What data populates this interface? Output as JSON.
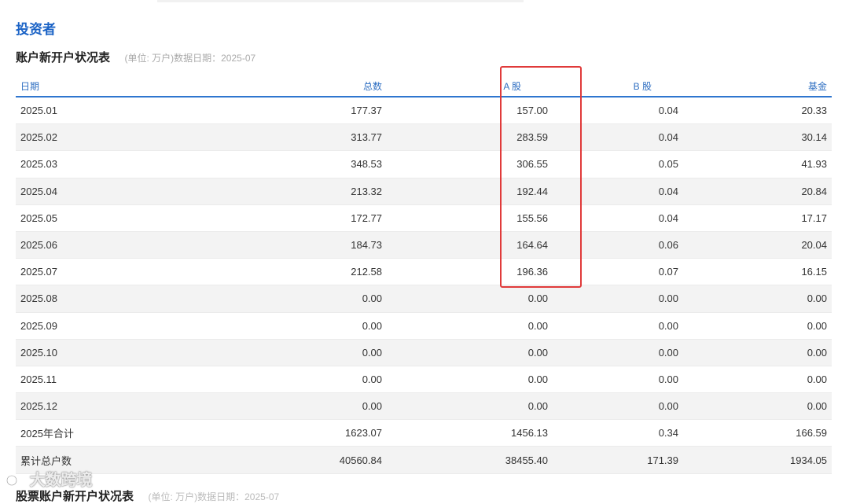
{
  "section": {
    "title": "投资者"
  },
  "table": {
    "title": "账户新开户状况表",
    "note": "(单位: 万户)数据日期：2025-07",
    "columns": [
      "日期",
      "总数",
      "A 股",
      "B 股",
      "基金"
    ],
    "rows": [
      [
        "2025.01",
        "177.37",
        "157.00",
        "0.04",
        "20.33"
      ],
      [
        "2025.02",
        "313.77",
        "283.59",
        "0.04",
        "30.14"
      ],
      [
        "2025.03",
        "348.53",
        "306.55",
        "0.05",
        "41.93"
      ],
      [
        "2025.04",
        "213.32",
        "192.44",
        "0.04",
        "20.84"
      ],
      [
        "2025.05",
        "172.77",
        "155.56",
        "0.04",
        "17.17"
      ],
      [
        "2025.06",
        "184.73",
        "164.64",
        "0.06",
        "20.04"
      ],
      [
        "2025.07",
        "212.58",
        "196.36",
        "0.07",
        "16.15"
      ],
      [
        "2025.08",
        "0.00",
        "0.00",
        "0.00",
        "0.00"
      ],
      [
        "2025.09",
        "0.00",
        "0.00",
        "0.00",
        "0.00"
      ],
      [
        "2025.10",
        "0.00",
        "0.00",
        "0.00",
        "0.00"
      ],
      [
        "2025.11",
        "0.00",
        "0.00",
        "0.00",
        "0.00"
      ],
      [
        "2025.12",
        "0.00",
        "0.00",
        "0.00",
        "0.00"
      ],
      [
        "2025年合计",
        "1623.07",
        "1456.13",
        "0.34",
        "166.59"
      ],
      [
        "累计总户数",
        "40560.84",
        "38455.40",
        "171.39",
        "1934.05"
      ]
    ]
  },
  "next_table": {
    "title": "股票账户新开户状况表",
    "note": "(单位: 万户)数据日期：2025-07"
  },
  "watermark": {
    "text": "大数跨境",
    "icon": "brand-logo-icon"
  },
  "colors": {
    "accent": "#1b63c6",
    "highlight": "#e03a3a"
  }
}
